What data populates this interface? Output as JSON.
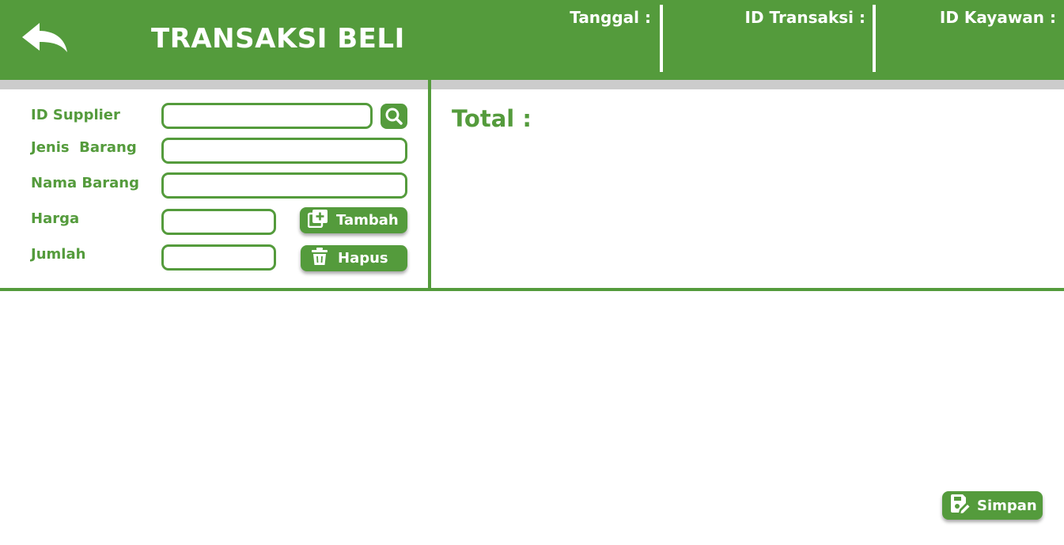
{
  "header": {
    "title": "TRANSAKSI BELI",
    "tanggal_label": "Tanggal :",
    "id_transaksi_label": "ID Transaksi :",
    "id_karyawan_label": "ID Kayawan :"
  },
  "form": {
    "id_supplier_label": "ID Supplier",
    "jenis_barang_label": "Jenis  Barang",
    "nama_barang_label": "Nama Barang",
    "harga_label": "Harga",
    "jumlah_label": "Jumlah",
    "id_supplier_value": "",
    "jenis_barang_value": "",
    "nama_barang_value": "",
    "harga_value": "",
    "jumlah_value": ""
  },
  "buttons": {
    "tambah": "Tambah",
    "hapus": "Hapus",
    "simpan": "Simpan"
  },
  "summary": {
    "total_label": "Total :"
  },
  "colors": {
    "primary": "#549b3c",
    "strip": "#cccccc",
    "background": "#ffffff"
  },
  "icons": {
    "back": "back-arrow-icon",
    "search": "search-icon",
    "add": "add-library-icon",
    "delete": "trash-icon",
    "save": "save-edit-icon"
  }
}
